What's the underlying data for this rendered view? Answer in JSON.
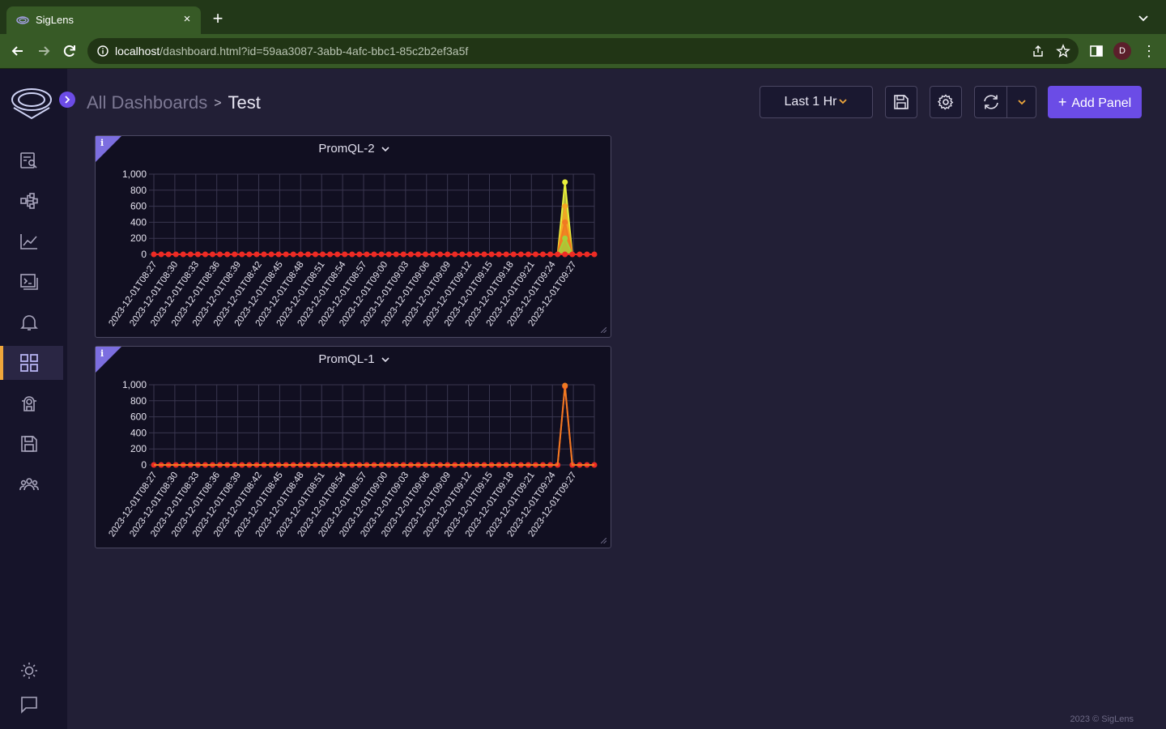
{
  "browser": {
    "tab_title": "SigLens",
    "tab_close": "×",
    "new_tab": "+",
    "url_host": "localhost",
    "url_path": "/dashboard.html?id=59aa3087-3abb-4afc-bbc1-85c2b2ef3a5f",
    "profile_initial": "D",
    "menu_glyph": "⋮"
  },
  "sidebar": {
    "items": [
      {
        "name": "logs-search-icon"
      },
      {
        "name": "tracing-icon"
      },
      {
        "name": "metrics-icon"
      },
      {
        "name": "query-builder-icon"
      },
      {
        "name": "alerts-icon"
      },
      {
        "name": "dashboards-icon",
        "active": true
      },
      {
        "name": "minion-icon"
      },
      {
        "name": "saved-queries-icon"
      },
      {
        "name": "cluster-icon"
      },
      {
        "name": "theme-toggle-icon"
      },
      {
        "name": "feedback-icon"
      }
    ]
  },
  "header": {
    "breadcrumb_root": "All Dashboards",
    "breadcrumb_sep": ">",
    "breadcrumb_current": "Test",
    "time_range": "Last 1 Hr",
    "add_panel_label": "Add Panel",
    "add_panel_plus": "+"
  },
  "colors": {
    "accent": "#6b4ce6",
    "active_indicator": "#f0a73b",
    "series_red": "#ee2b24",
    "series_yellow": "#e9f03c",
    "series_orange": "#f07a22",
    "grid": "#3a3750"
  },
  "chart_data": [
    {
      "type": "line",
      "title": "PromQL-2",
      "ylim": [
        0,
        1000
      ],
      "y_ticks": [
        "0",
        "200",
        "400",
        "600",
        "800",
        "1,000"
      ],
      "x_tick_labels": [
        "2023-12-01T08:27",
        "2023-12-01T08:30",
        "2023-12-01T08:33",
        "2023-12-01T08:36",
        "2023-12-01T08:39",
        "2023-12-01T08:42",
        "2023-12-01T08:45",
        "2023-12-01T08:48",
        "2023-12-01T08:51",
        "2023-12-01T08:54",
        "2023-12-01T08:57",
        "2023-12-01T09:00",
        "2023-12-01T09:03",
        "2023-12-01T09:06",
        "2023-12-01T09:09",
        "2023-12-01T09:12",
        "2023-12-01T09:15",
        "2023-12-01T09:18",
        "2023-12-01T09:21",
        "2023-12-01T09:24",
        "2023-12-01T09:27"
      ],
      "points_per_series": 61,
      "grid": true,
      "series": [
        {
          "color": "#e9f03c",
          "spike_index": 56,
          "spike_value": 900,
          "fill": true
        },
        {
          "color": "#f5a623",
          "spike_index": 56,
          "spike_value": 600,
          "fill": true
        },
        {
          "color": "#f07a22",
          "spike_index": 56,
          "spike_value": 400,
          "fill": true
        },
        {
          "color": "#a3d13a",
          "spike_index": 56,
          "spike_value": 200,
          "fill": true
        },
        {
          "color": "#ee2b24",
          "spike_index": 56,
          "spike_value": 0,
          "fill": false
        }
      ]
    },
    {
      "type": "line",
      "title": "PromQL-1",
      "ylim": [
        0,
        1000
      ],
      "y_ticks": [
        "0",
        "200",
        "400",
        "600",
        "800",
        "1,000"
      ],
      "x_tick_labels": [
        "2023-12-01T08:27",
        "2023-12-01T08:30",
        "2023-12-01T08:33",
        "2023-12-01T08:36",
        "2023-12-01T08:39",
        "2023-12-01T08:42",
        "2023-12-01T08:45",
        "2023-12-01T08:48",
        "2023-12-01T08:51",
        "2023-12-01T08:54",
        "2023-12-01T08:57",
        "2023-12-01T09:00",
        "2023-12-01T09:03",
        "2023-12-01T09:06",
        "2023-12-01T09:09",
        "2023-12-01T09:12",
        "2023-12-01T09:15",
        "2023-12-01T09:18",
        "2023-12-01T09:21",
        "2023-12-01T09:24",
        "2023-12-01T09:27"
      ],
      "points_per_series": 61,
      "grid": true,
      "series": [
        {
          "color": "#ee2b24",
          "spike_index": 56,
          "spike_value": 980,
          "fill": false
        },
        {
          "color": "#f07a22",
          "spike_index": 56,
          "spike_value": 990,
          "fill": false
        }
      ]
    }
  ],
  "footer": "2023 © SigLens"
}
